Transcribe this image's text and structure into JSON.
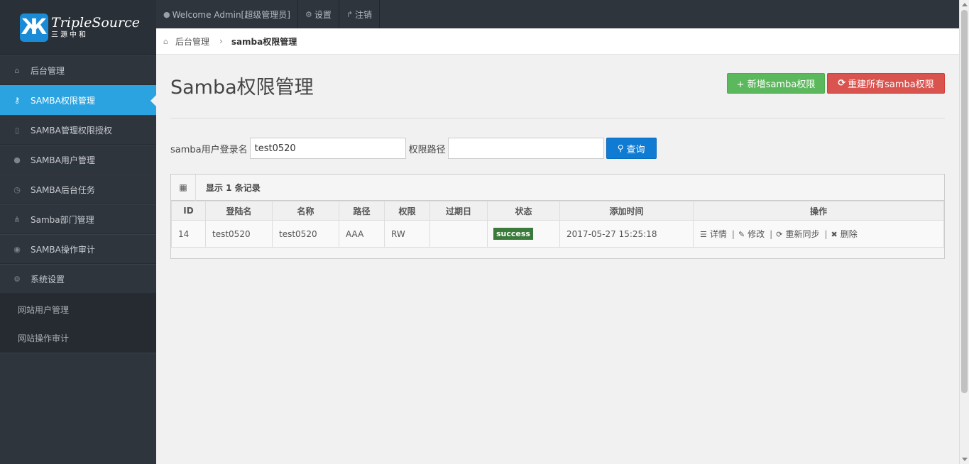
{
  "logo": {
    "mark": "Ж",
    "brand": "TripleSource",
    "sub": "三源中和"
  },
  "sidebar": {
    "items": [
      {
        "icon": "⌂",
        "label": "后台管理"
      },
      {
        "icon": "⚷",
        "label": "SAMBA权限管理"
      },
      {
        "icon": "▯",
        "label": "SAMBA管理权限授权"
      },
      {
        "icon": "●",
        "label": "SAMBA用户管理"
      },
      {
        "icon": "◷",
        "label": "SAMBA后台任务"
      },
      {
        "icon": "⋔",
        "label": "Samba部门管理"
      },
      {
        "icon": "◉",
        "label": "SAMBA操作审计"
      },
      {
        "icon": "⚙",
        "label": "系统设置"
      }
    ],
    "subitems": [
      {
        "label": "网站用户管理"
      },
      {
        "label": "网站操作审计"
      }
    ]
  },
  "topbar": {
    "welcome": "Welcome Admin[超级管理员]",
    "settings": "设置",
    "logout": "注销"
  },
  "breadcrumb": {
    "home": "后台管理",
    "current": "samba权限管理"
  },
  "page": {
    "title": "Samba权限管理",
    "add_button": "+ 新增samba权限",
    "rebuild_button": "重建所有samba权限"
  },
  "search": {
    "user_label": "samba用户登录名",
    "user_value": "test0520",
    "path_label": "权限路径",
    "path_value": "",
    "query_button": "查询"
  },
  "table": {
    "caption": "显示 1 条记录",
    "headers": [
      "ID",
      "登陆名",
      "名称",
      "路径",
      "权限",
      "过期日",
      "状态",
      "添加时间",
      "操作"
    ],
    "rows": [
      {
        "id": "14",
        "login": "test0520",
        "name": "test0520",
        "path": "AAA",
        "perm": "RW",
        "expire": "",
        "status": "success",
        "added": "2017-05-27 15:25:18",
        "ops": {
          "detail": "详情",
          "edit": "修改",
          "resync": "重新同步",
          "delete": "删除"
        }
      }
    ]
  },
  "colors": {
    "active": "#2aa3e0",
    "success": "#5cb85c",
    "danger": "#d9534f",
    "primary": "#0f7bd3"
  }
}
